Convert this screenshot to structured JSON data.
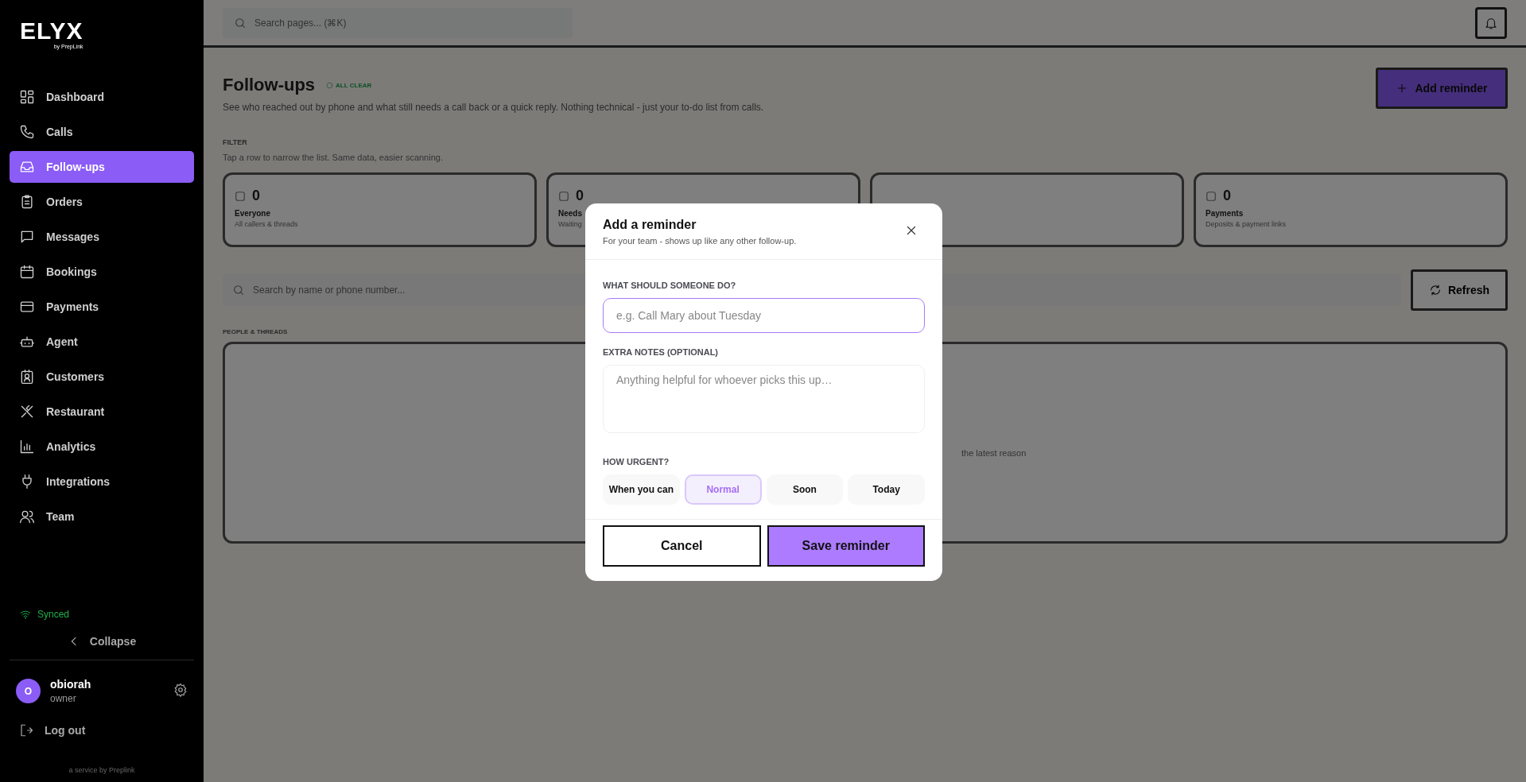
{
  "sidebar": {
    "logo": "ELYX",
    "logo_sub": "by PrepLink",
    "items": [
      {
        "label": "Dashboard",
        "selected": false
      },
      {
        "label": "Calls",
        "selected": false
      },
      {
        "label": "Follow-ups",
        "selected": true
      },
      {
        "label": "Orders",
        "selected": false
      },
      {
        "label": "Messages",
        "selected": false
      },
      {
        "label": "Bookings",
        "selected": false
      },
      {
        "label": "Payments",
        "selected": false
      },
      {
        "label": "Agent",
        "selected": false
      },
      {
        "label": "Customers",
        "selected": false
      },
      {
        "label": "Restaurant",
        "selected": false
      },
      {
        "label": "Analytics",
        "selected": false
      },
      {
        "label": "Integrations",
        "selected": false
      },
      {
        "label": "Team",
        "selected": false
      }
    ],
    "sync_status": "Synced",
    "collapse": "Collapse",
    "user": {
      "initial": "O",
      "name": "obiorah",
      "role": "owner"
    },
    "logout": "Log out",
    "footer": "a service by Preplink"
  },
  "header": {
    "search": {
      "placeholder": "Search pages... (⌘K)"
    }
  },
  "page": {
    "title": "Follow-ups",
    "status_badge": "ALL CLEAR",
    "description": "See who reached out by phone and what still needs a call back or a quick reply. Nothing technical - just your to-do list from calls.",
    "add_button": "Add reminder",
    "filter": {
      "label": "FILTER",
      "hint": "Tap a row to narrow the list. Same data, easier scanning.",
      "cards": [
        {
          "kind": "stat",
          "count": "0",
          "label": "Everyone",
          "sub": "All callers & threads"
        },
        {
          "kind": "stat",
          "count": "0",
          "label": "Needs",
          "sub": "Waiting"
        },
        {
          "kind": "blank"
        },
        {
          "kind": "stat",
          "count": "0",
          "label": "Payments",
          "sub": "Deposits & payment links"
        }
      ]
    },
    "search": {
      "placeholder": "Search by name or phone number..."
    },
    "refresh_button": "Refresh",
    "list": {
      "label": "PEOPLE & THREADS",
      "empty_text": "the latest reason"
    }
  },
  "dialog": {
    "title": "Add a reminder",
    "subtitle": "For your team - shows up like any other follow-up.",
    "task_label": "WHAT SHOULD SOMEONE DO?",
    "task_placeholder": "e.g. Call Mary about Tuesday",
    "notes_label": "EXTRA NOTES (OPTIONAL)",
    "notes_placeholder": "Anything helpful for whoever picks this up…",
    "urgency_label": "HOW URGENT?",
    "urgency": [
      {
        "label": "When you can",
        "selected": false
      },
      {
        "label": "Normal",
        "selected": true
      },
      {
        "label": "Soon",
        "selected": false
      },
      {
        "label": "Today",
        "selected": false
      }
    ],
    "cancel_button": "Cancel",
    "save_button": "Save reminder"
  }
}
